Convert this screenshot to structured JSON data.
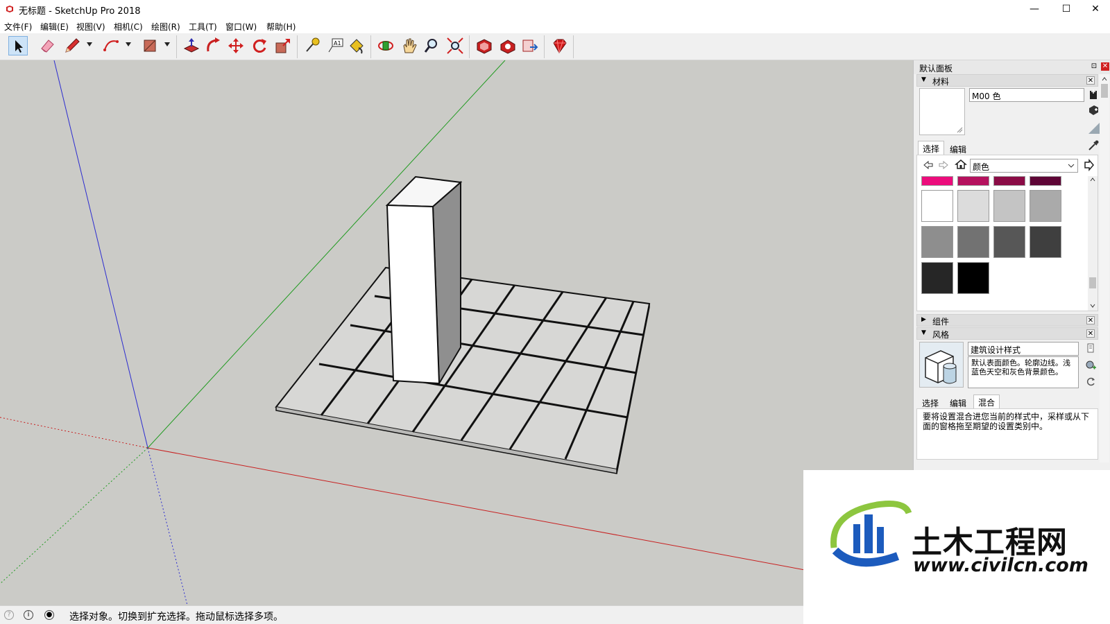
{
  "window": {
    "title": "无标题 - SketchUp Pro 2018",
    "minimize_glyph": "—",
    "maximize_glyph": "☐",
    "close_glyph": "✕"
  },
  "menu": [
    "文件(F)",
    "编辑(E)",
    "视图(V)",
    "相机(C)",
    "绘图(R)",
    "工具(T)",
    "窗口(W)",
    "帮助(H)"
  ],
  "toolbar": {
    "icons": [
      "select-arrow-icon",
      "eraser-icon",
      "pencil-line-icon",
      "arc-icon",
      "rectangle-icon",
      "push-pull-icon",
      "follow-me-icon",
      "move-icon",
      "rotate-icon",
      "scale-icon",
      "tape-measure-icon",
      "text-label-icon",
      "paint-bucket-icon",
      "orbit-icon",
      "pan-hand-icon",
      "zoom-icon",
      "zoom-extents-icon",
      "3d-warehouse-icon",
      "extension-warehouse-icon",
      "layout-send-icon",
      "ruby-extension-icon"
    ]
  },
  "tray": {
    "title": "默认面板",
    "pin_glyph": "⊡",
    "close_glyph": "✕",
    "materials": {
      "header": "材料",
      "name_value": "M00 色",
      "tab_select": "选择",
      "tab_edit": "编辑",
      "category_value": "颜色",
      "colors": {
        "top_row": [
          "#ec0c7c",
          "#b5115e",
          "#8b0c46",
          "#5e0536"
        ],
        "row1": [
          "#ffffff",
          "#dcdcdc",
          "#c4c4c4",
          "#aaaaaa"
        ],
        "row2": [
          "#8e8e8e",
          "#727272",
          "#575757",
          "#3f3f3f"
        ],
        "row3": [
          "#262626",
          "#000000"
        ]
      }
    },
    "components": {
      "header": "组件"
    },
    "styles": {
      "header": "风格",
      "style_name": "建筑设计样式",
      "style_desc": "默认表面颜色。轮廓边线。浅蓝色天空和灰色背景颜色。",
      "tab_select": "选择",
      "tab_edit": "编辑",
      "tab_mix": "混合",
      "mix_hint": "要将设置混合进您当前的样式中，采样或从下面的窗格拖至期望的设置类别中。"
    }
  },
  "status": {
    "text": "选择对象。切换到扩充选择。拖动鼠标选择多项。"
  },
  "watermark": {
    "name": "土木工程网",
    "url": "www.civilcn.com"
  },
  "colors": {
    "viewport_bg": "#cbcbc7",
    "axis_red": "#c81e1e",
    "axis_green": "#1f9a1f",
    "axis_blue": "#2121c0",
    "face": "#ffffff",
    "ground_tile": "#d7d7d5"
  }
}
